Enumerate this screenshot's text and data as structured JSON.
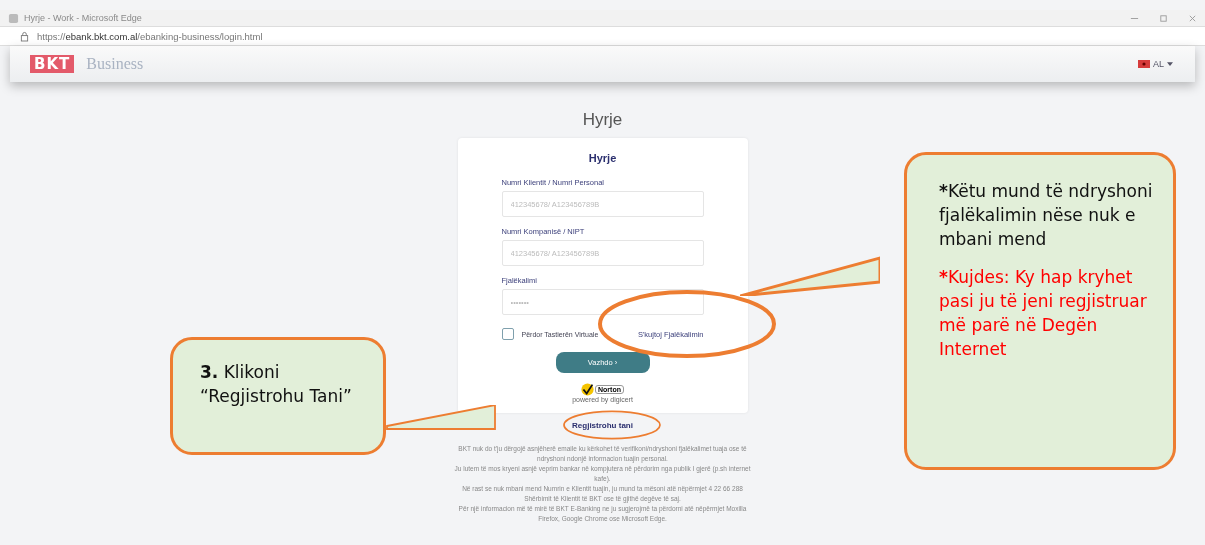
{
  "browser": {
    "title": "Hyrje - Work - Microsoft Edge",
    "url_host": "ebank.bkt.com.al",
    "url_prefix": "https://",
    "url_path": "/ebanking-business/login.html"
  },
  "header": {
    "logo": "BKT",
    "brand": "Business",
    "language": "AL"
  },
  "page_title": "Hyrje",
  "login_card": {
    "title": "Hyrje",
    "fields": [
      {
        "label": "Numri Klientit / Numri Personal",
        "placeholder": "412345678/ A123456789B"
      },
      {
        "label": "Numri Kompanisë / NIPT",
        "placeholder": "412345678/ A123456789B"
      },
      {
        "label": "Fjalëkalimi",
        "placeholder": "•••••••"
      }
    ],
    "virtual_keyboard": {
      "label": "Përdor Tastierën Virtuale",
      "checked": false
    },
    "forgot_link": "S'kujtoj Fjalëkalimin",
    "submit": "Vazhdo ›",
    "seal": {
      "name": "Norton",
      "powered": "powered by digicert"
    }
  },
  "register_link": "Regjistrohu tani",
  "disclaimer": [
    "BKT nuk do t'ju dërgojë asnjëherë emaile ku kërkohet të verifikoni/ndryshoni fjalëkalimet tuaja ose të ndryshoni ndonjë informacion tuajin personal.",
    "Ju lutem të mos kryeni asnjë veprim bankar në kompjutera në përdorim nga publik I gjerë (p.sh internet kafe).",
    "Në rast se nuk mbani mend Numrin e Klientit tuajin, ju mund ta mësoni atë nëpërmjet 4 22 66 288 Shërbimit të Klientit të BKT ose të gjithë degëve të saj.",
    "Për një informacion më të mirë të BKT E-Banking ne ju sugjerojmë ta përdorni atë nëpërmjet Moxilla Firefox, Google Chrome ose Microsoft Edge."
  ],
  "callouts": [
    {
      "paragraphs": [
        {
          "kind": "note",
          "mark": "3.",
          "text": " Klikoni “Regjistrohu Tani”"
        }
      ]
    },
    {
      "paragraphs": [
        {
          "kind": "note",
          "mark": "*",
          "text": "Këtu mund të ndryshoni fjalëkalimin nëse nuk e mbani mend"
        },
        {
          "kind": "warning",
          "mark": "*",
          "text": "Kujdes: Ky hap kryhet pasi ju të jeni regjistruar më parë në Degën Internet"
        }
      ]
    }
  ]
}
